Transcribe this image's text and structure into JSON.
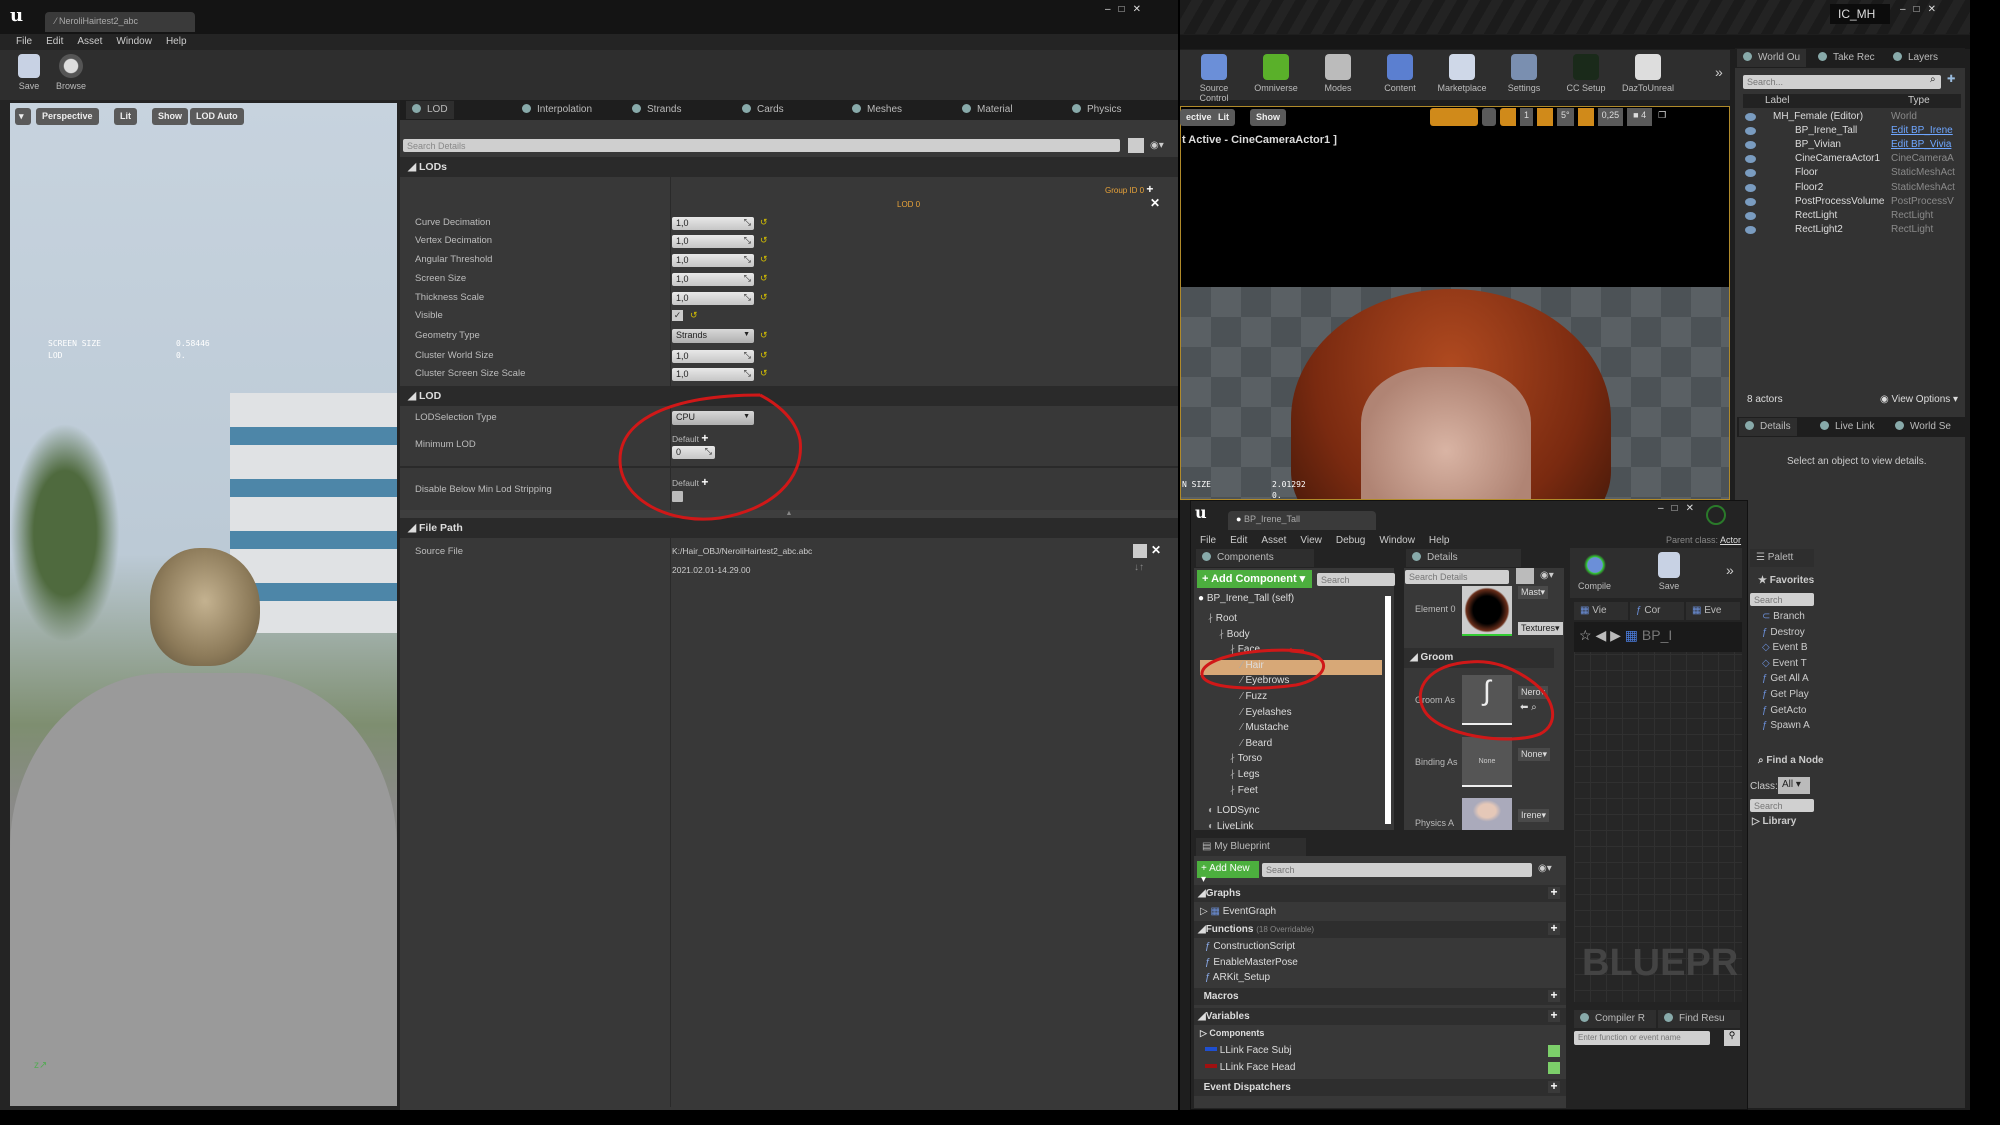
{
  "left_window": {
    "tab_title": "NeroliHairtest2_abc",
    "menu": [
      "File",
      "Edit",
      "Asset",
      "Window",
      "Help"
    ],
    "toolbar": [
      {
        "label": "Save",
        "icon": "save-icon"
      },
      {
        "label": "Browse",
        "icon": "browse-icon"
      }
    ],
    "viewport": {
      "buttons": [
        "Perspective",
        "Lit",
        "Show",
        "LOD Auto"
      ],
      "stats": [
        {
          "label": "SCREEN SIZE",
          "value": "0.58446"
        },
        {
          "label": "LOD",
          "value": "0."
        }
      ]
    },
    "details": {
      "tabs": [
        "LOD",
        "Interpolation",
        "Strands",
        "Cards",
        "Meshes",
        "Material",
        "Physics"
      ],
      "search_placeholder": "Search Details",
      "lods_section": "LODs",
      "group_id": "Group ID 0",
      "lod_label": "LOD 0",
      "lod_rows": [
        {
          "label": "Curve Decimation",
          "value": "1,0",
          "kind": "num"
        },
        {
          "label": "Vertex Decimation",
          "value": "1,0",
          "kind": "num"
        },
        {
          "label": "Angular Threshold",
          "value": "1,0",
          "kind": "num"
        },
        {
          "label": "Screen Size",
          "value": "1,0",
          "kind": "num"
        },
        {
          "label": "Thickness Scale",
          "value": "1,0",
          "kind": "num"
        },
        {
          "label": "Visible",
          "value": "",
          "kind": "check"
        },
        {
          "label": "Geometry Type",
          "value": "Strands",
          "kind": "drop"
        },
        {
          "label": "Cluster World Size",
          "value": "1,0",
          "kind": "num"
        },
        {
          "label": "Cluster Screen Size Scale",
          "value": "1,0",
          "kind": "num"
        }
      ],
      "lod_section": "LOD",
      "lod_selection_label": "LODSelection Type",
      "lod_selection_value": "CPU",
      "min_lod_label": "Minimum LOD",
      "min_lod_default": "Default",
      "min_lod_value": "0",
      "disable_label": "Disable Below Min Lod Stripping",
      "disable_default": "Default",
      "disable_checked": false,
      "file_section": "File Path",
      "source_label": "Source File",
      "source_path": "K:/Hair_OBJ/NeroliHairtest2_abc.abc",
      "source_date": "2021.02.01-14.29.00"
    }
  },
  "main_editor": {
    "profile": "IC_MH",
    "toolbar": [
      "Source Control",
      "Omniverse",
      "Modes",
      "Content",
      "Marketplace",
      "Settings",
      "CC Setup",
      "DazToUnreal"
    ],
    "viewport": {
      "buttons": [
        "ective",
        "Lit",
        "Show"
      ],
      "pilot_text": "t Active - CineCameraActor1 ]",
      "snap_values": [
        "1",
        "5°",
        "0,25",
        "4"
      ],
      "stats": [
        {
          "label": "N SIZE",
          "value": "2.01292"
        },
        {
          "label": "",
          "value": "0."
        }
      ]
    },
    "outliner": {
      "tabs": [
        "World Ou",
        "Take Rec",
        "Layers"
      ],
      "search_placeholder": "Search...",
      "col_label": "Label",
      "col_type": "Type",
      "rows": [
        {
          "name": "MH_Female (Editor)",
          "type": "World",
          "link": false
        },
        {
          "name": "BP_Irene_Tall",
          "type": "Edit BP_Irene",
          "link": true
        },
        {
          "name": "BP_Vivian",
          "type": "Edit BP_Vivia",
          "link": true
        },
        {
          "name": "CineCameraActor1",
          "type": "CineCameraA",
          "link": false
        },
        {
          "name": "Floor",
          "type": "StaticMeshAct",
          "link": false
        },
        {
          "name": "Floor2",
          "type": "StaticMeshAct",
          "link": false
        },
        {
          "name": "PostProcessVolume",
          "type": "PostProcessV",
          "link": false
        },
        {
          "name": "RectLight",
          "type": "RectLight",
          "link": false
        },
        {
          "name": "RectLight2",
          "type": "RectLight",
          "link": false
        }
      ],
      "count": "8 actors",
      "view_options": "View Options",
      "bottom_tabs": [
        "Details",
        "Live Link",
        "World Se"
      ],
      "empty_msg": "Select an object to view details."
    }
  },
  "blueprint_window": {
    "tab_title": "BP_Irene_Tall",
    "menu": [
      "File",
      "Edit",
      "Asset",
      "View",
      "Debug",
      "Window",
      "Help"
    ],
    "parent_class_label": "Parent class:",
    "parent_class": "Actor",
    "components": {
      "tab": "Components",
      "add_button": "+ Add Component",
      "search_placeholder": "Search",
      "self": "BP_Irene_Tall (self)",
      "tree": [
        {
          "label": "Root",
          "depth": 0
        },
        {
          "label": "Body",
          "depth": 1
        },
        {
          "label": "Face",
          "depth": 2
        },
        {
          "label": "Hair",
          "depth": 3,
          "selected": true
        },
        {
          "label": "Eyebrows",
          "depth": 3
        },
        {
          "label": "Fuzz",
          "depth": 3
        },
        {
          "label": "Eyelashes",
          "depth": 3
        },
        {
          "label": "Mustache",
          "depth": 3
        },
        {
          "label": "Beard",
          "depth": 3
        },
        {
          "label": "Torso",
          "depth": 2
        },
        {
          "label": "Legs",
          "depth": 2
        },
        {
          "label": "Feet",
          "depth": 2
        },
        {
          "label": "LODSync",
          "depth": 0
        },
        {
          "label": "LiveLink",
          "depth": 0
        }
      ]
    },
    "details": {
      "tab": "Details",
      "search_placeholder": "Search Details",
      "element_label": "Element 0",
      "element_drop": "Mast",
      "element_drop2": "Textures",
      "groom_section": "Groom",
      "groom_label": "Groom As",
      "groom_drop": "Nero",
      "binding_label": "Binding As",
      "binding_thumb": "None",
      "binding_drop": "None",
      "physics_label": "Physics A",
      "physics_drop": "Irene"
    },
    "toolbar": {
      "compile": "Compile",
      "save": "Save"
    },
    "graph_tabs": [
      "Vie",
      "Cor",
      "Eve"
    ],
    "graph_breadcrumb": "BP_I",
    "graph_watermark": "BLUEPR",
    "palette": {
      "tab": "Palett",
      "favorites": "Favorites",
      "search_placeholder": "Search",
      "items": [
        "Branch",
        "Destroy",
        "Event B",
        "Event T",
        "Get All A",
        "Get Play",
        "GetActo",
        "Spawn A"
      ],
      "find_node": "Find a Node",
      "class_label": "Class:",
      "class_value": "All",
      "search2_placeholder": "Search",
      "library": "Library"
    },
    "my_blueprint": {
      "tab": "My Blueprint",
      "add_new": "+ Add New",
      "search_placeholder": "Search",
      "graphs": "Graphs",
      "event_graph": "EventGraph",
      "functions": "Functions",
      "functions_note": "(18 Overridable)",
      "function_items": [
        "ConstructionScript",
        "EnableMasterPose",
        "ARKit_Setup"
      ],
      "macros": "Macros",
      "variables": "Variables",
      "components": "Components",
      "variable_items": [
        {
          "label": "LLink Face Subj",
          "color": "#1f4fd0"
        },
        {
          "label": "LLink Face Head",
          "color": "#a01010"
        }
      ],
      "event_dispatchers": "Event Dispatchers"
    },
    "compiler": {
      "tabs": [
        "Compiler R",
        "Find Resu"
      ],
      "search_placeholder": "Enter function or event name"
    }
  },
  "colors": {
    "accent": "#e8a33a",
    "annotation": "#d01818",
    "add_green": "#4caf3e",
    "selected_row": "#d7a877"
  }
}
